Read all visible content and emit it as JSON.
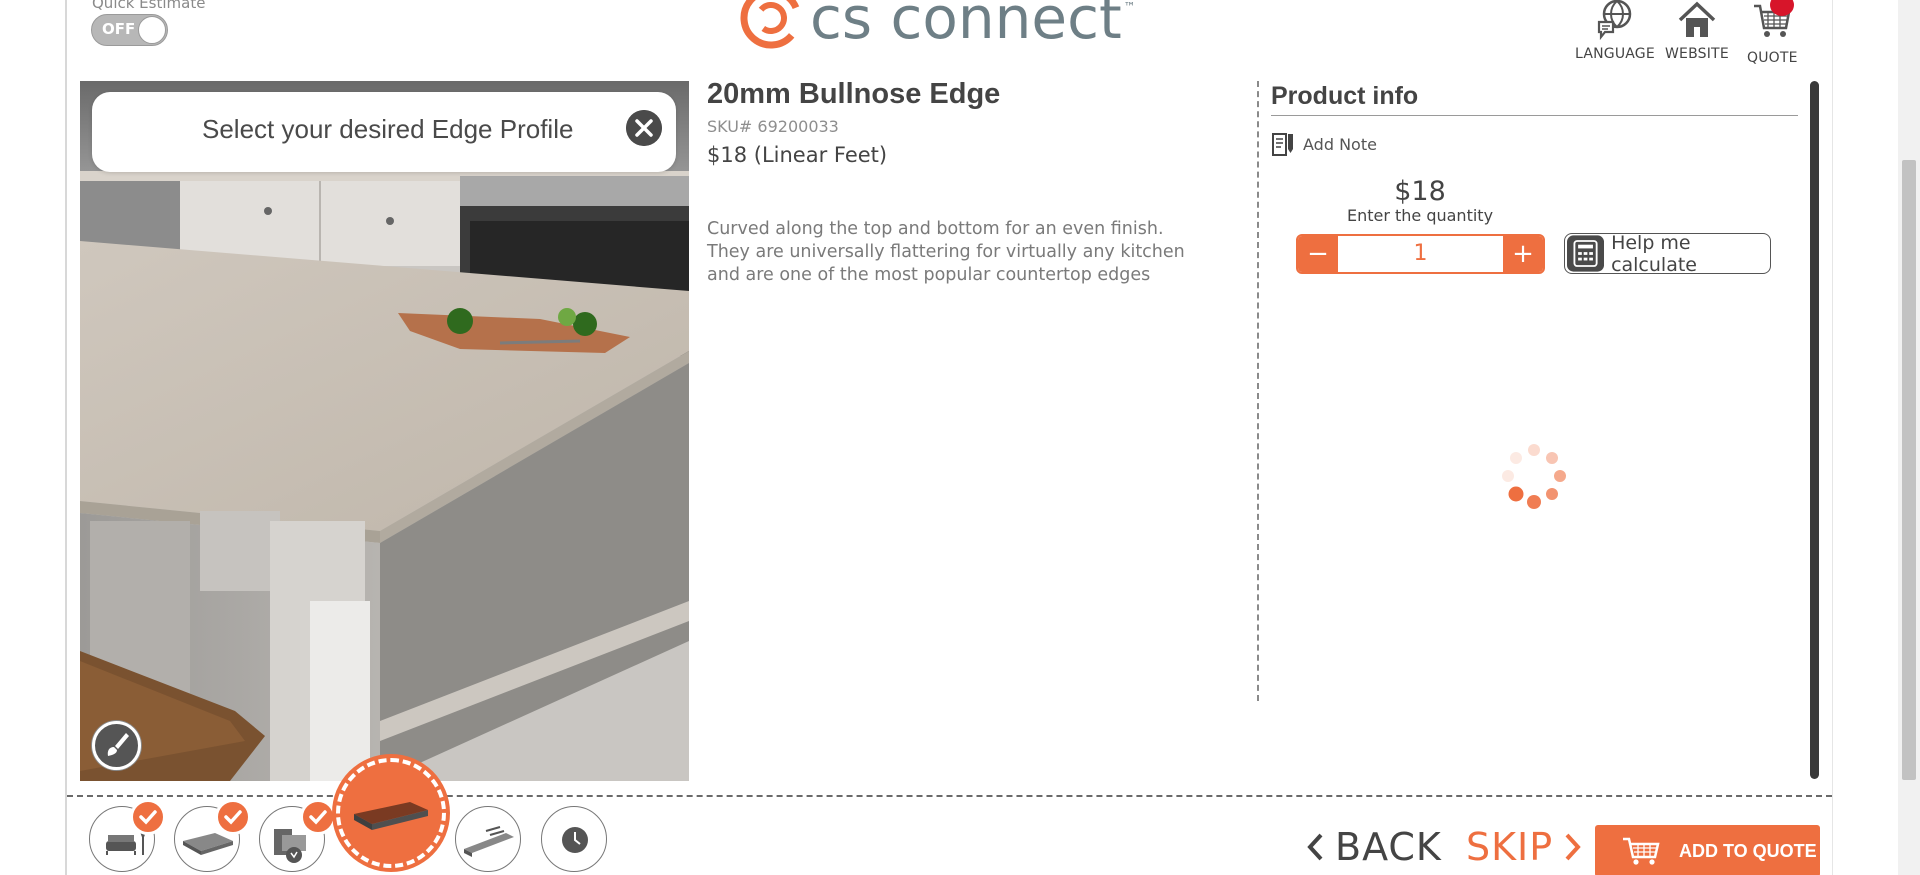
{
  "header": {
    "quick_estimate_label": "Quick Estimate",
    "quick_estimate_state": "OFF",
    "logo_text": "cs connect",
    "logo_tm": "™",
    "buttons": [
      {
        "label": "LANGUAGE",
        "icon": "globe-chat-icon"
      },
      {
        "label": "WEBSITE",
        "icon": "home-icon"
      },
      {
        "label": "QUOTE",
        "icon": "cart-icon"
      }
    ]
  },
  "hero": {
    "tooltip": "Select your desired Edge Profile",
    "close_icon": "close-icon",
    "brush_icon": "paint-brush-icon"
  },
  "product": {
    "title": "20mm Bullnose Edge",
    "sku": "SKU# 69200033",
    "price": "$18 (Linear Feet)",
    "description": "Curved along the top and bottom for an even finish. They are universally flattering for virtually any kitchen and are one of the most popular countertop edges"
  },
  "info": {
    "title": "Product info",
    "add_note": "Add Note",
    "unit_price": "$18",
    "qty_hint": "Enter the quantity",
    "qty_value": "1",
    "minus": "−",
    "plus": "+",
    "help_label": "Help me calculate"
  },
  "steps": [
    {
      "icon": "furniture-icon",
      "completed": true
    },
    {
      "icon": "countertop-slab-icon",
      "completed": true
    },
    {
      "icon": "sink-faucet-icon",
      "completed": true
    },
    {
      "icon": "edge-profile-icon",
      "completed": false,
      "active": true
    },
    {
      "icon": "backsplash-icon",
      "completed": false
    },
    {
      "icon": "clock-icon",
      "completed": false
    }
  ],
  "nav": {
    "back": "BACK",
    "skip": "SKIP",
    "add_to_quote": "ADD TO QUOTE"
  },
  "colors": {
    "accent": "#ee6f40",
    "logo": "#6e7f86",
    "badge": "#d7152a"
  }
}
